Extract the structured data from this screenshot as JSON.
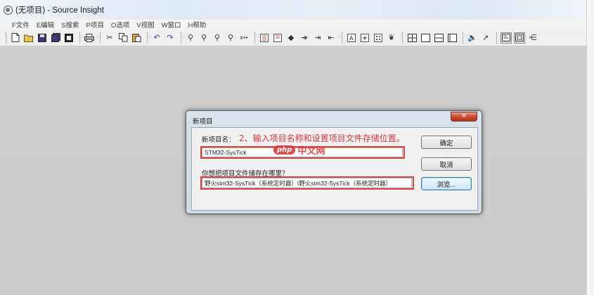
{
  "window": {
    "title": "(无项目) - Source Insight"
  },
  "menu": [
    "F文件",
    "E编辑",
    "S搜索",
    "P项目",
    "O选项",
    "V视图",
    "W窗口",
    "H帮助"
  ],
  "toolbar": {
    "icons": [
      "new-file-icon",
      "open-folder-icon",
      "save-icon",
      "save-all-icon",
      "close-file-icon",
      "print-icon",
      "cut-icon",
      "copy-icon",
      "paste-icon",
      "undo-icon",
      "redo-icon",
      "find-icon",
      "find-previous-icon",
      "find-next-icon",
      "lookup-references-icon",
      "replace-icon",
      "bookmark-icon",
      "bookmark-list-icon",
      "go-back-icon",
      "go-forward-icon",
      "jump-prev-icon",
      "jump-next-icon",
      "symbol-window-icon",
      "relation-window-icon",
      "project-window-icon",
      "browse-project-icon",
      "layout-grid-icon",
      "single-window-icon",
      "split-horizontal-icon",
      "split-vertical-icon",
      "speaker-icon",
      "pointer-icon",
      "context-window-icon",
      "toolbar-toggle-icon",
      "more-icon"
    ]
  },
  "dialog": {
    "title": "新项目",
    "close_glyph": "✕",
    "name_label": "新项目名：",
    "annotation": "2、输入项目名称和设置项目文件存储位置。",
    "name_value": "STM32-SysTick",
    "path_label": "你想把项目文件储存在哪里？",
    "path_value": "野火stm32-SysTick（系统定时器）\\野火stm32-SysTick（系统定时器）",
    "ok_label": "确定",
    "cancel_label": "取消",
    "browse_label": "浏览..."
  },
  "watermark": {
    "badge": "php",
    "text": "中文网"
  },
  "colors": {
    "annotation": "#d23a3a",
    "highlight_border": "#d94545",
    "close_button": "#c7432a"
  }
}
